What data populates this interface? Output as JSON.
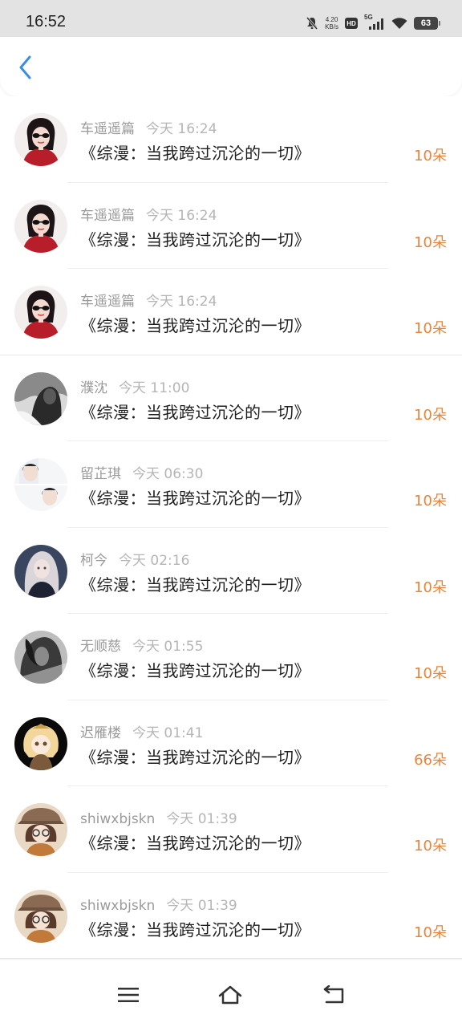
{
  "status_bar": {
    "time": "16:52",
    "speed_value": "4.20",
    "speed_unit": "KB/s",
    "hd": "HD",
    "network": "5G",
    "battery": "63"
  },
  "header": {
    "back_icon": "chevron-left-icon",
    "accent_color": "#3a8ee6"
  },
  "colors": {
    "amount": "#e9843a",
    "username": "#9a9a9a",
    "time": "#b5b5b5"
  },
  "items": [
    {
      "user": "车遥遥篇",
      "time": "今天 16:24",
      "title": "《综漫：当我跨过沉沦的一切》",
      "amount": "10朵"
    },
    {
      "user": "车遥遥篇",
      "time": "今天 16:24",
      "title": "《综漫：当我跨过沉沦的一切》",
      "amount": "10朵"
    },
    {
      "user": "车遥遥篇",
      "time": "今天 16:24",
      "title": "《综漫：当我跨过沉沦的一切》",
      "amount": "10朵"
    },
    {
      "user": "濮沈",
      "time": "今天 11:00",
      "title": "《综漫：当我跨过沉沦的一切》",
      "amount": "10朵"
    },
    {
      "user": "留芷琪",
      "time": "今天 06:30",
      "title": "《综漫：当我跨过沉沦的一切》",
      "amount": "10朵"
    },
    {
      "user": "柯今",
      "time": "今天 02:16",
      "title": "《综漫：当我跨过沉沦的一切》",
      "amount": "10朵"
    },
    {
      "user": "无顺慈",
      "time": "今天 01:55",
      "title": "《综漫：当我跨过沉沦的一切》",
      "amount": "10朵"
    },
    {
      "user": "迟雁楼",
      "time": "今天 01:41",
      "title": "《综漫：当我跨过沉沦的一切》",
      "amount": "66朵"
    },
    {
      "user": "shiwxbjskn",
      "time": "今天 01:39",
      "title": "《综漫：当我跨过沉沦的一切》",
      "amount": "10朵"
    },
    {
      "user": "shiwxbjskn",
      "time": "今天 01:39",
      "title": "《综漫：当我跨过沉沦的一切》",
      "amount": "10朵"
    }
  ],
  "nav": {
    "menu_icon": "menu-icon",
    "home_icon": "home-icon",
    "back_icon": "back-icon"
  }
}
